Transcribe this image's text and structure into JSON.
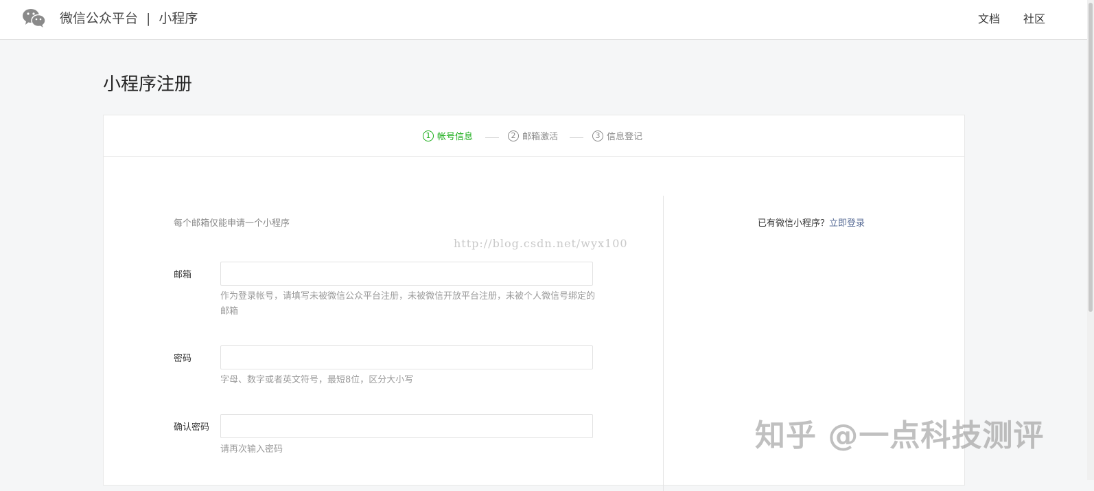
{
  "header": {
    "brand_name": "微信公众平台",
    "separator": "|",
    "section": "小程序",
    "nav": [
      {
        "label": "文档"
      },
      {
        "label": "社区"
      }
    ],
    "logo_icon": "wechat-logo-icon"
  },
  "page": {
    "title": "小程序注册"
  },
  "steps": [
    {
      "num": "1",
      "label": "帐号信息",
      "active": true
    },
    {
      "num": "2",
      "label": "邮箱激活",
      "active": false
    },
    {
      "num": "3",
      "label": "信息登记",
      "active": false
    }
  ],
  "form": {
    "tip": "每个邮箱仅能申请一个小程序",
    "fields": [
      {
        "label": "邮箱",
        "value": "",
        "placeholder": "",
        "hint": "作为登录帐号，请填写未被微信公众平台注册，未被微信开放平台注册，未被个人微信号绑定的邮箱"
      },
      {
        "label": "密码",
        "value": "",
        "placeholder": "",
        "hint": "字母、数字或者英文符号，最短8位，区分大小写"
      },
      {
        "label": "确认密码",
        "value": "",
        "placeholder": "",
        "hint": "请再次输入密码"
      }
    ]
  },
  "sidebar": {
    "prompt": "已有微信小程序？",
    "login_link": "立即登录"
  },
  "watermarks": {
    "url": "http://blog.csdn.net/wyx100",
    "zhihu": "知乎 @一点科技测评"
  },
  "colors": {
    "accent_green": "#1aad19",
    "link_blue": "#576b95",
    "page_bg": "#f5f6f7"
  }
}
